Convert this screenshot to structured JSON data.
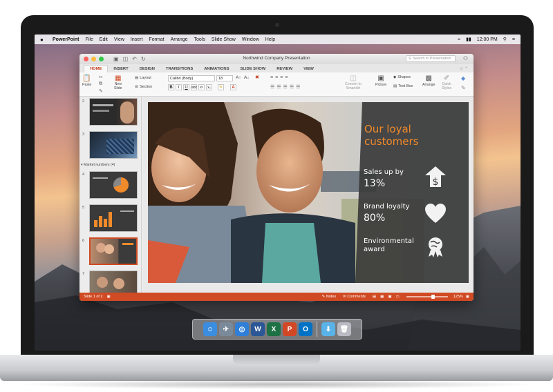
{
  "menubar": {
    "apple": "",
    "app_name": "PowerPoint",
    "items": [
      "File",
      "Edit",
      "View",
      "Insert",
      "Format",
      "Arrange",
      "Tools",
      "Slide Show",
      "Window",
      "Help"
    ],
    "clock": "12:00 PM"
  },
  "window": {
    "title": "Northwind Company Presentation",
    "search_placeholder": "Search in Presentation"
  },
  "ribbon_tabs": [
    "HOME",
    "INSERT",
    "DESIGN",
    "TRANSITIONS",
    "ANIMATIONS",
    "SLIDE SHOW",
    "REVIEW",
    "VIEW"
  ],
  "ribbon": {
    "paste": "Paste",
    "new_slide": "New\nSlide",
    "layout": "Layout",
    "section": "Section",
    "font_name": "Calibri (Body)",
    "font_size": "18",
    "convert_smartart": "Convert to\nSmartArt",
    "picture": "Picture",
    "shapes": "Shapes",
    "text_box": "Text Box",
    "arrange": "Arrange",
    "quick_styles": "Quick\nStyles"
  },
  "thumbnails": {
    "numbers": [
      "2",
      "3",
      "4",
      "5",
      "6",
      "7"
    ],
    "section_header": "Market numbers (4)"
  },
  "slide": {
    "title": "Our loyal\ncustomers",
    "stats": [
      {
        "label": "Sales up by",
        "value": "13%",
        "icon": "dollar-arrow-icon"
      },
      {
        "label": "Brand loyalty",
        "value": "80%",
        "icon": "heart-icon"
      },
      {
        "label": "Environmental\naward",
        "value": "",
        "icon": "globe-award-icon"
      }
    ],
    "accent_color": "#f08a2a",
    "panel_color": "#3b3b3b"
  },
  "statusbar": {
    "slide_counter": "Slide 1 of 2",
    "notes": "Notes",
    "comments": "Comments",
    "zoom": "125%"
  },
  "dock": {
    "apps": [
      {
        "icon": "finder-icon",
        "glyph": "☺",
        "color": "#3b8de0"
      },
      {
        "icon": "launchpad-icon",
        "glyph": "✈",
        "color": "#7a8a9a"
      },
      {
        "icon": "safari-icon",
        "glyph": "◎",
        "color": "#2f7fd8"
      },
      {
        "icon": "word-icon",
        "glyph": "W",
        "color": "#2b5797"
      },
      {
        "icon": "excel-icon",
        "glyph": "X",
        "color": "#1e7145"
      },
      {
        "icon": "powerpoint-icon",
        "glyph": "P",
        "color": "#d24726"
      },
      {
        "icon": "outlook-icon",
        "glyph": "O",
        "color": "#0072c6"
      }
    ],
    "extras": [
      {
        "icon": "downloads-folder-icon",
        "glyph": "⬇",
        "color": "#5ab3e8"
      },
      {
        "icon": "trash-icon",
        "glyph": "🗑",
        "color": "#b8bcc2"
      }
    ]
  }
}
